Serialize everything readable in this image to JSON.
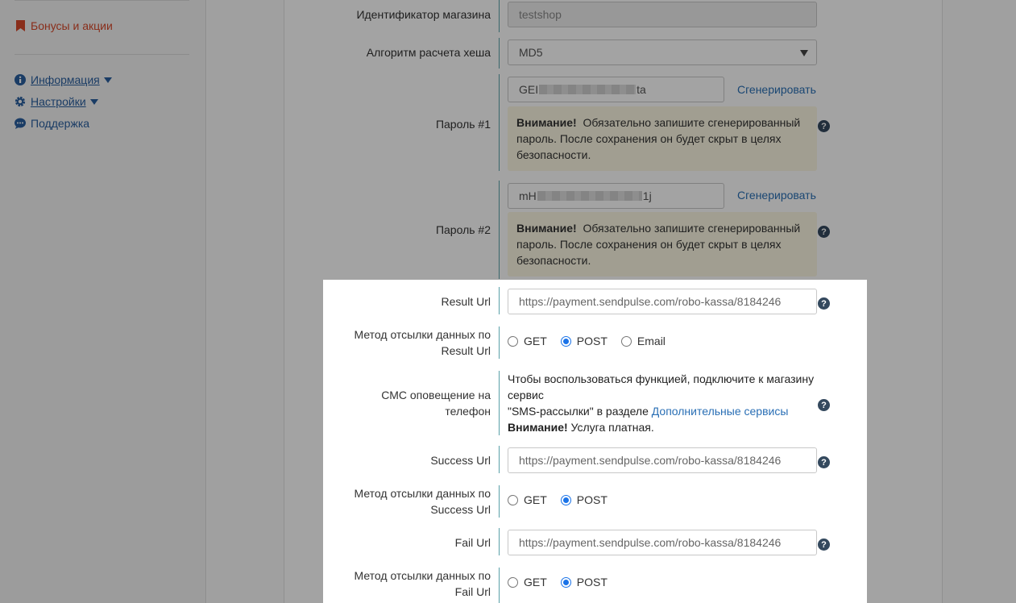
{
  "sidebar": {
    "bonus_label": "Бонусы и акции",
    "info_label": "Информация",
    "settings_label": "Настройки",
    "support_label": "Поддержка"
  },
  "form": {
    "shop_id": {
      "label": "Идентификатор магазина",
      "value": "testshop"
    },
    "hash_algo": {
      "label": "Алгоритм расчета хеша",
      "value": "MD5"
    },
    "password1": {
      "label": "Пароль #1",
      "value_start": "GEI",
      "value_end": "ta",
      "generate": "Сгенерировать"
    },
    "password2": {
      "label": "Пароль #2",
      "value_start": "mH",
      "value_end": "1j",
      "generate": "Сгенерировать"
    },
    "warning": {
      "bold": "Внимание!",
      "text": "Обязательно запишите сгенерированный пароль. После сохранения он будет скрыт в целях безопасности."
    },
    "result_url": {
      "label": "Result Url",
      "placeholder": "https://payment.sendpulse.com/robo-kassa/8184246"
    },
    "result_method": {
      "label": "Метод отсылки данных по Result Url",
      "options": [
        "GET",
        "POST",
        "Email"
      ],
      "selected": "POST"
    },
    "sms": {
      "label": "СМС оповещение на телефон",
      "line1": "Чтобы воспользоваться функцией, подключите к магазину сервис",
      "line2": "\"SMS-рассылки\" в разделе",
      "link": "Дополнительные сервисы",
      "bold": "Внимание!",
      "tail": "Услуга платная."
    },
    "success_url": {
      "label": "Success Url",
      "placeholder": "https://payment.sendpulse.com/robo-kassa/8184246"
    },
    "success_method": {
      "label": "Метод отсылки данных по Success Url",
      "options": [
        "GET",
        "POST"
      ],
      "selected": "POST"
    },
    "fail_url": {
      "label": "Fail Url",
      "placeholder": "https://payment.sendpulse.com/robo-kassa/8184246"
    },
    "fail_method": {
      "label": "Метод отсылки данных по Fail Url",
      "options": [
        "GET",
        "POST"
      ],
      "selected": "POST"
    }
  },
  "help_glyph": "?",
  "colors": {
    "accent": "#2a6fb5",
    "warning_bg": "#fcf8e3",
    "radio_on": "#1a73e8",
    "bonus": "#d6492b"
  }
}
